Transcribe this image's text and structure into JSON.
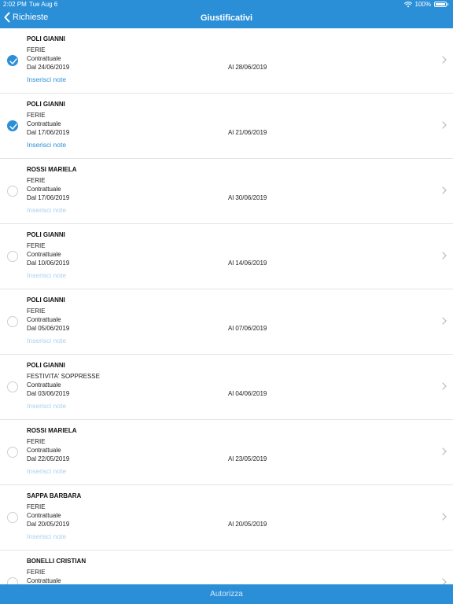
{
  "status": {
    "time": "2:02 PM",
    "date": "Tue Aug 6",
    "battery": "100%"
  },
  "nav": {
    "back_label": "Richieste",
    "title": "Giustificativi"
  },
  "items": [
    {
      "name": "POLI GIANNI",
      "type": "FERIE",
      "kind": "Contrattuale",
      "from": "Dal 24/06/2019",
      "to": "Al 28/06/2019",
      "notes": "Inserisci note",
      "checked": true
    },
    {
      "name": "POLI GIANNI",
      "type": "FERIE",
      "kind": "Contrattuale",
      "from": "Dal 17/06/2019",
      "to": "Al 21/06/2019",
      "notes": "Inserisci note",
      "checked": true
    },
    {
      "name": "ROSSI MARIELA",
      "type": "FERIE",
      "kind": "Contrattuale",
      "from": "Dal 17/06/2019",
      "to": "Al 30/06/2019",
      "notes": "Inserisci note",
      "checked": false
    },
    {
      "name": "POLI GIANNI",
      "type": "FERIE",
      "kind": "Contrattuale",
      "from": "Dal 10/06/2019",
      "to": "Al 14/06/2019",
      "notes": "Inserisci note",
      "checked": false
    },
    {
      "name": "POLI GIANNI",
      "type": "FERIE",
      "kind": "Contrattuale",
      "from": "Dal 05/06/2019",
      "to": "Al 07/06/2019",
      "notes": "Inserisci note",
      "checked": false
    },
    {
      "name": "POLI GIANNI",
      "type": "FESTIVITA' SOPPRESSE",
      "kind": "Contrattuale",
      "from": "Dal 03/06/2019",
      "to": "Al 04/06/2019",
      "notes": "Inserisci note",
      "checked": false
    },
    {
      "name": "ROSSI MARIELA",
      "type": "FERIE",
      "kind": "Contrattuale",
      "from": "Dal 22/05/2019",
      "to": "Al 23/05/2019",
      "notes": "Inserisci note",
      "checked": false
    },
    {
      "name": "SAPPA BARBARA",
      "type": "FERIE",
      "kind": "Contrattuale",
      "from": "Dal 20/05/2019",
      "to": "Al 20/05/2019",
      "notes": "Inserisci note",
      "checked": false
    },
    {
      "name": "BONELLI CRISTIAN",
      "type": "FERIE",
      "kind": "Contrattuale",
      "from": "",
      "to": "",
      "notes": "",
      "checked": false
    }
  ],
  "footer": {
    "authorize_label": "Autorizza"
  },
  "colors": {
    "accent": "#2b8fd8",
    "notes_active": "#2b8fd8",
    "notes_inactive": "#a9d0ee"
  }
}
